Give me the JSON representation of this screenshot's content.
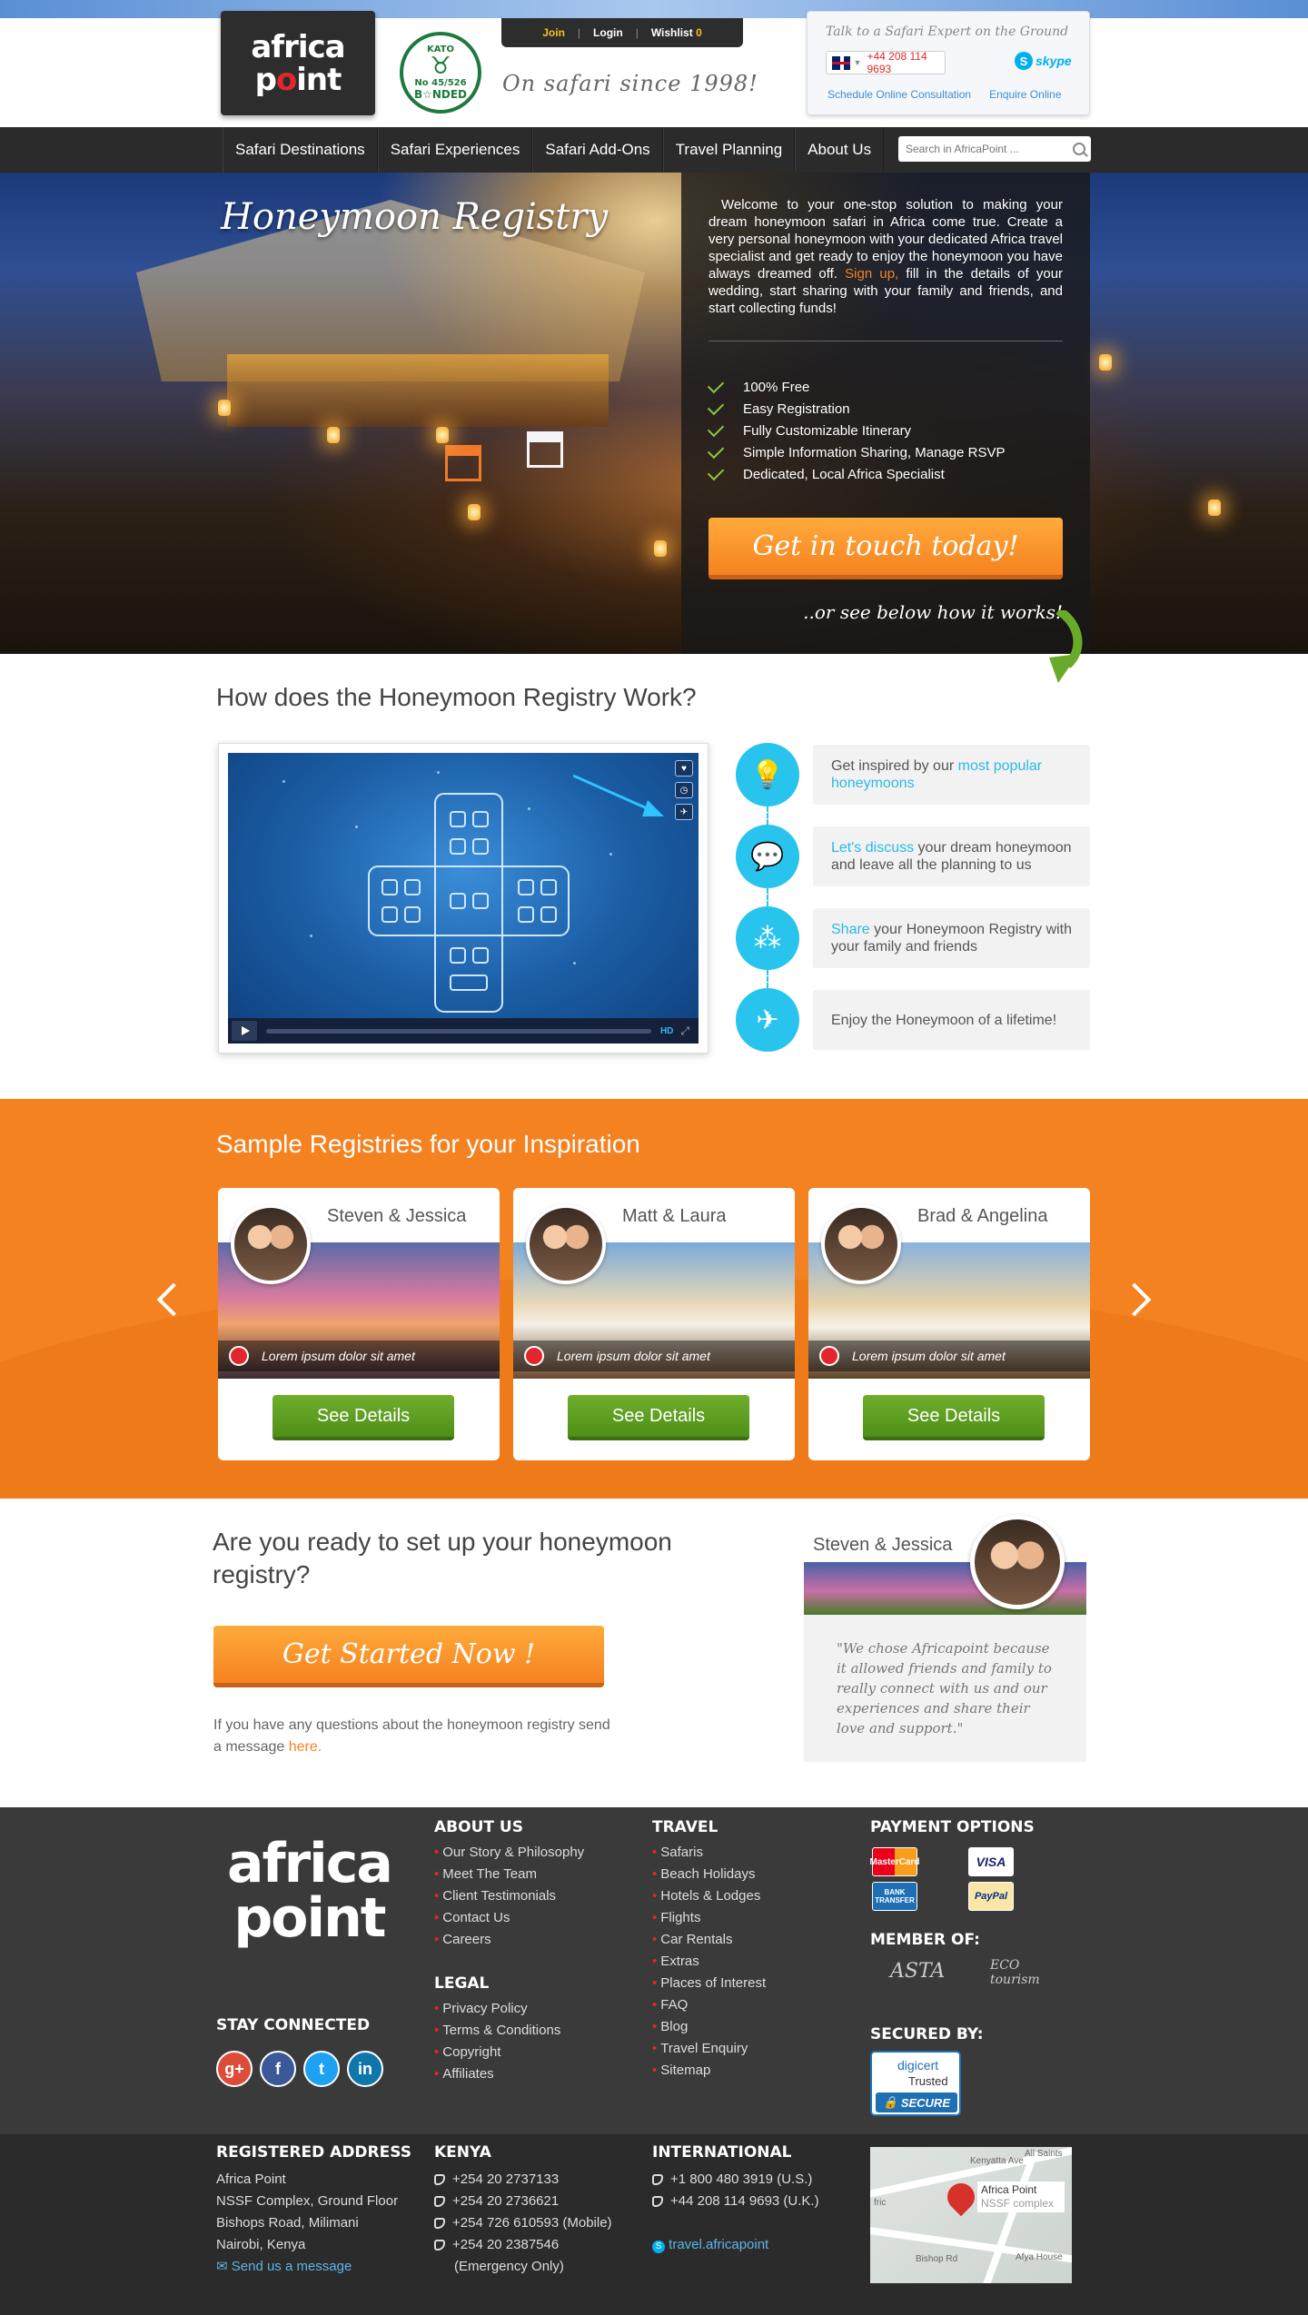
{
  "header": {
    "logo_line1": "africa",
    "logo_line2": "p",
    "logo_line2_dot": "o",
    "logo_line2_end": "int",
    "kato_top": "KATO",
    "kato_mid": "B☆NDED",
    "kato_no": "No 45/526",
    "tagline": "On safari since 1998!",
    "userbar": {
      "join": "Join",
      "login": "Login",
      "wishlist": "Wishlist",
      "wishlist_count": "0",
      "sep": "|"
    },
    "expert": {
      "title": "Talk to a Safari Expert on the Ground",
      "phone": "+44 208 114 9693",
      "skype": "skype",
      "link_consult": "Schedule Online Consultation",
      "link_enquire": "Enquire Online"
    }
  },
  "nav": {
    "items": [
      "Safari Destinations",
      "Safari Experiences",
      "Safari Add-Ons",
      "Travel Planning",
      "About Us"
    ],
    "search_placeholder": "Search in AfricaPoint ..."
  },
  "hero": {
    "title": "Honeymoon Registry",
    "intro_before": "Welcome to your one-stop solution to making your dream honeymoon safari in Africa come true. Create a very personal honeymoon with your dedicated Africa travel specialist and get ready to enjoy the honeymoon you have always dreamed off.",
    "intro_signup": "Sign up,",
    "intro_after": "fill in the details of your wedding, start sharing with your family and friends, and start collecting funds!",
    "features": [
      "100% Free",
      "Easy Registration",
      "Fully Customizable Itinerary",
      "Simple Information Sharing, Manage RSVP",
      "Dedicated, Local Africa Specialist"
    ],
    "cta": "Get in touch today!",
    "below": "..or see below how it works!"
  },
  "how": {
    "title": "How does the Honeymoon Registry Work?",
    "video": {
      "hd": "HD"
    },
    "steps": [
      {
        "pre": "Get inspired by our ",
        "hl": "most popular honeymoons",
        "post": "",
        "icon": "lightbulb-icon"
      },
      {
        "pre": "",
        "hl": "Let's discuss",
        "post": " your dream honeymoon and leave all the planning to us",
        "icon": "chat-icon"
      },
      {
        "pre": "",
        "hl": "Share",
        "post": " your Honeymoon Registry with your family and friends",
        "icon": "share-icon"
      },
      {
        "pre": "Enjoy the Honeymoon of a lifetime!",
        "hl": "",
        "post": "",
        "icon": "airplane-icon"
      }
    ]
  },
  "samples": {
    "title": "Sample Registries for your Inspiration",
    "cards": [
      {
        "names": "Steven & Jessica",
        "caption": "Lorem ipsum dolor sit amet",
        "button": "See Details"
      },
      {
        "names": "Matt & Laura",
        "caption": "Lorem ipsum dolor sit amet",
        "button": "See Details"
      },
      {
        "names": "Brad & Angelina",
        "caption": "Lorem ipsum dolor sit amet",
        "button": "See Details"
      }
    ]
  },
  "ready": {
    "title": "Are you ready to set up your honeymoon registry?",
    "cta": "Get Started Now !",
    "note_before": "If you have any questions about the honeymoon registry send a message",
    "note_link": "here.",
    "testimonial_names": "Steven & Jessica",
    "testimonial_quote": "\"We chose Africapoint because it allowed friends and family to really connect with us and our experiences and share their love and support.\""
  },
  "footer": {
    "logo_line1": "africa",
    "logo_line2": "point",
    "stay_connected": "STAY CONNECTED",
    "about_head": "ABOUT US",
    "about_items": [
      "Our Story & Philosophy",
      "Meet The Team",
      "Client Testimonials",
      "Contact Us",
      "Careers"
    ],
    "legal_head": "LEGAL",
    "legal_items": [
      "Privacy Policy",
      "Terms & Conditions",
      "Copyright",
      "Affiliates"
    ],
    "travel_head": "TRAVEL",
    "travel_items": [
      "Safaris",
      "Beach Holidays",
      "Hotels & Lodges",
      "Flights",
      "Car Rentals",
      "Extras",
      "Places of Interest",
      "FAQ",
      "Blog",
      "Travel Enquiry",
      "Sitemap"
    ],
    "payment_head": "PAYMENT OPTIONS",
    "payments": [
      "MasterCard",
      "VISA",
      "BANK TRANSFER",
      "PayPal"
    ],
    "member_head": "MEMBER OF:",
    "members": [
      "ASTA",
      "ECO tourism"
    ],
    "secured_head": "SECURED BY:",
    "digicert": {
      "brand": "digicert",
      "trusted": "Trusted",
      "secure": "SECURE"
    },
    "address_head": "REGISTERED ADDRESS",
    "address_lines": [
      "Africa Point",
      "NSSF Complex, Ground Floor",
      "Bishops Road, Milimani",
      "Nairobi, Kenya"
    ],
    "address_link": "Send us a message",
    "kenya_head": "KENYA",
    "kenya_phones": [
      "+254 20 2737133",
      "+254 20 2736621",
      "+254 726 610593 (Mobile)",
      "+254 20 2387546"
    ],
    "kenya_note": "(Emergency Only)",
    "intl_head": "INTERNATIONAL",
    "intl_phones": [
      "+1 800 480 3919 (U.S.)",
      "+44 208 114 9693 (U.K.)"
    ],
    "skype_id": "travel.africapoint",
    "map": {
      "place": "Africa Point",
      "sub": "NSSF complex",
      "road1": "Kenyatta Ave",
      "road2": "Bishop Rd",
      "corner": "All Saints",
      "house": "Afya House",
      "fric": "fric"
    }
  },
  "colors": {
    "accent_orange": "#f58220",
    "accent_cyan": "#29c4ee",
    "green_button": "#5a9e1f",
    "dark": "#2b2b2b"
  }
}
